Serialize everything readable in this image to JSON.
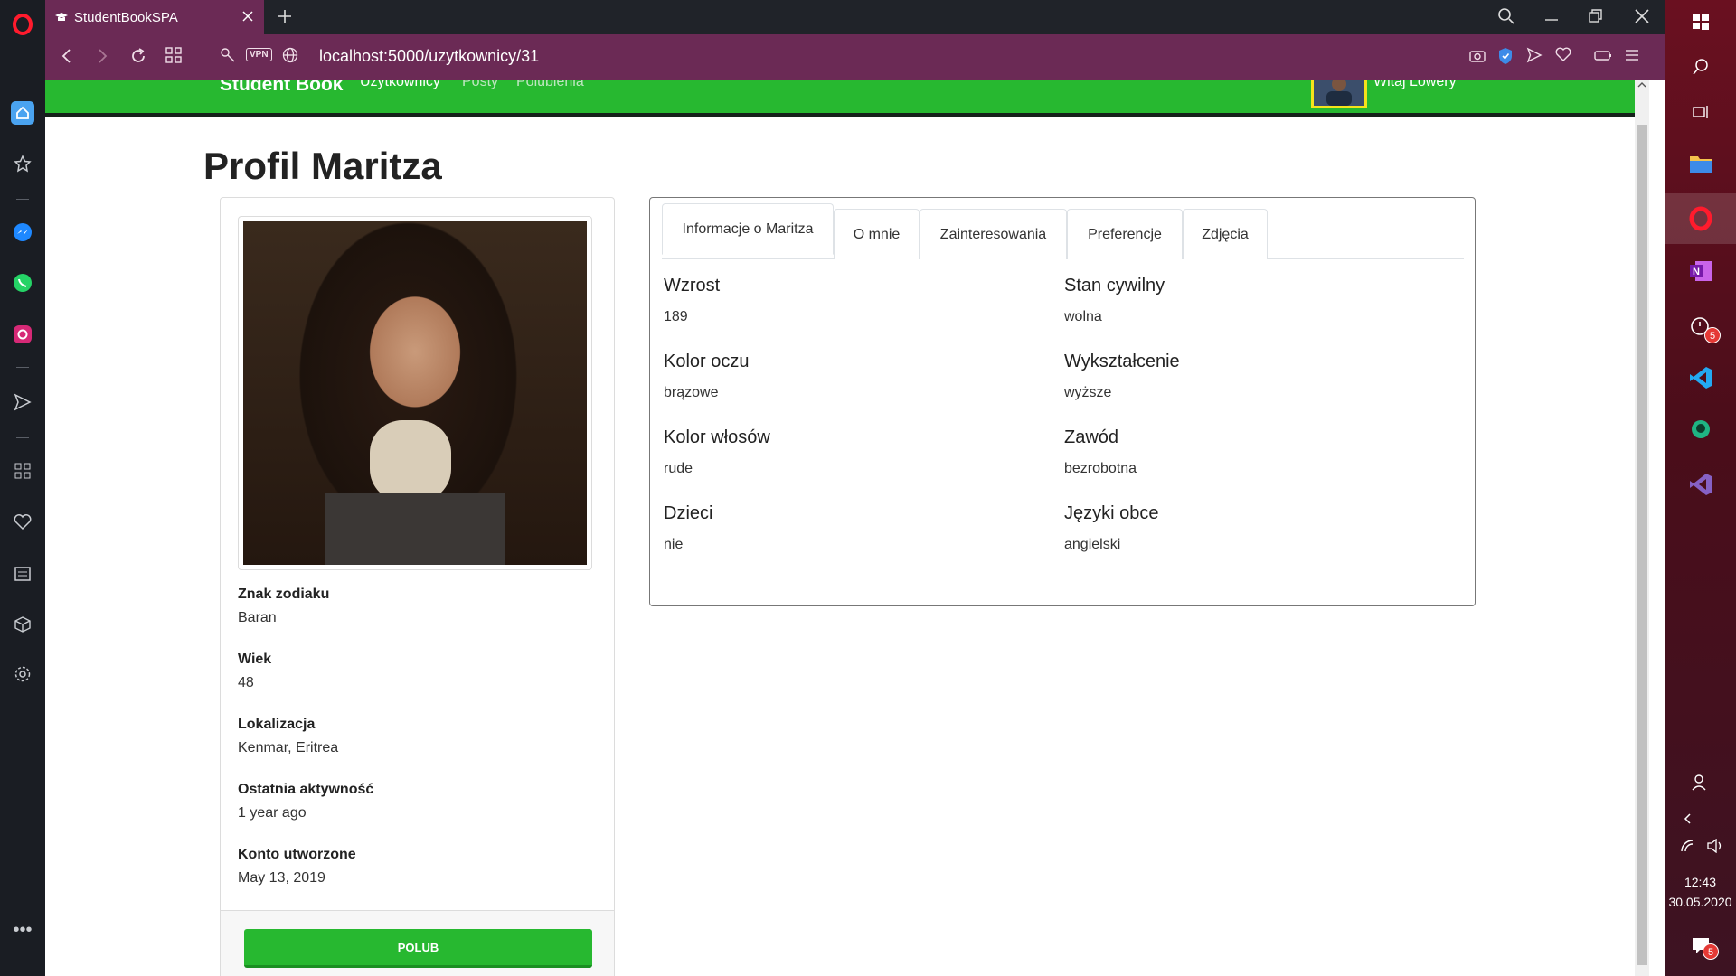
{
  "browser": {
    "tab_title": "StudentBookSPA",
    "url": "localhost:5000/uzytkownicy/31",
    "vpn_label": "VPN"
  },
  "navbar": {
    "brand": "Student Book",
    "links": [
      "Użytkownicy",
      "Posty",
      "Polubienia"
    ],
    "welcome": "Witaj Lowery"
  },
  "page": {
    "title": "Profil Maritza"
  },
  "profile_card": {
    "fields": [
      {
        "label": "Znak zodiaku",
        "value": "Baran"
      },
      {
        "label": "Wiek",
        "value": "48"
      },
      {
        "label": "Lokalizacja",
        "value": "Kenmar, Eritrea"
      },
      {
        "label": "Ostatnia aktywność",
        "value": "1 year ago"
      },
      {
        "label": "Konto utworzone",
        "value": "May 13, 2019"
      }
    ],
    "like_button": "POLUB"
  },
  "tabs": [
    "Informacje o Maritza",
    "O mnie",
    "Zainteresowania",
    "Preferencje",
    "Zdjęcia"
  ],
  "details": [
    {
      "label": "Wzrost",
      "value": "189"
    },
    {
      "label": "Stan cywilny",
      "value": "wolna"
    },
    {
      "label": "Kolor oczu",
      "value": "brązowe"
    },
    {
      "label": "Wykształcenie",
      "value": "wyższe"
    },
    {
      "label": "Kolor włosów",
      "value": "rude"
    },
    {
      "label": "Zawód",
      "value": "bezrobotna"
    },
    {
      "label": "Dzieci",
      "value": "nie"
    },
    {
      "label": "Języki obce",
      "value": "angielski"
    }
  ],
  "taskbar": {
    "time": "12:43",
    "date": "30.05.2020",
    "badges": [
      "5",
      "5"
    ]
  },
  "colors": {
    "navbar_green": "#27b830",
    "browser_purple": "#6b2a55",
    "taskbar_red": "#6a1020"
  }
}
